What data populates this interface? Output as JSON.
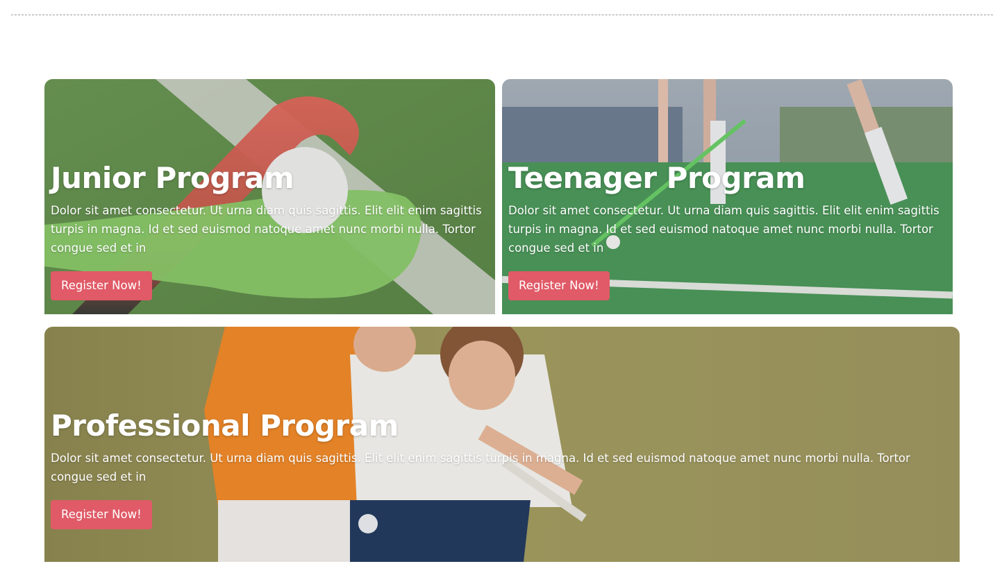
{
  "colors": {
    "accent": "#e05a67",
    "divider": "#9a9a9a"
  },
  "programs": [
    {
      "title": "Junior Program",
      "description": "Dolor sit amet consectetur. Ut urna diam quis sagittis. Elit elit enim sagittis turpis in magna. Id et sed euismod natoque amet nunc morbi nulla. Tortor congue sed et in",
      "button_label": "Register Now!",
      "image": "hockey-stick-and-ball-photo"
    },
    {
      "title": "Teenager Program",
      "description": "Dolor sit amet consectetur. Ut urna diam quis sagittis. Elit elit enim sagittis turpis in magna. Id et sed euismod natoque amet nunc morbi nulla. Tortor congue sed et in",
      "button_label": "Register Now!",
      "image": "players-legs-on-field-photo"
    },
    {
      "title": "Professional Program",
      "description": "Dolor sit amet consectetur. Ut urna diam quis sagittis. Elit elit enim sagittis turpis in magna. Id et sed euismod natoque amet nunc morbi nulla. Tortor congue sed et in",
      "button_label": "Register Now!",
      "image": "two-players-tackling-photo"
    }
  ]
}
